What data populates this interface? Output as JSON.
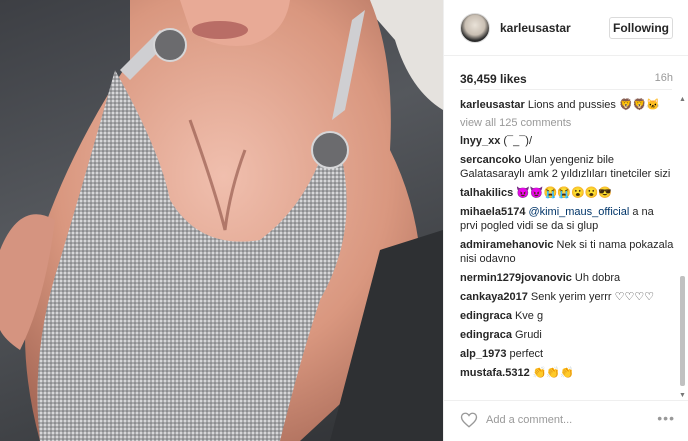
{
  "post": {
    "username": "karleusastar",
    "follow_label": "Following",
    "likes": "36,459 likes",
    "time_ago": "16h"
  },
  "caption": {
    "user": "karleusastar",
    "text": "Lions and pussies 🦁🦁🐱"
  },
  "view_all": "view all 125 comments",
  "comments": [
    {
      "user": "lnyy_xx",
      "text": "(¯_¯)/"
    },
    {
      "user": "sercancoko",
      "text": "Ulan yengeniz bile Galatasaraylı amk 2 yıldızlıları tinetciler sizi"
    },
    {
      "user": "talhakilics",
      "text": "😈😈😭😭😮😮😎"
    },
    {
      "user": "mihaela5174",
      "mention": "@kimi_maus_official",
      "text": " a na prvi pogled vidi se da si glup"
    },
    {
      "user": "admiramehanovic",
      "text": "Nek si ti nama pokazala nisi odavno"
    },
    {
      "user": "nermin1279jovanovic",
      "text": "Uh dobra"
    },
    {
      "user": "cankaya2017",
      "text": "Senk yerim yerrr ♡♡♡♡"
    },
    {
      "user": "edingraca",
      "text": "Kve g"
    },
    {
      "user": "edingraca",
      "text": "Grudi"
    },
    {
      "user": "alp_1973",
      "text": "perfect"
    },
    {
      "user": "mustafa.5312",
      "text": "👏👏👏"
    }
  ],
  "footer": {
    "placeholder": "Add a comment...",
    "more": "•••"
  },
  "icons": {
    "heart": "heart-icon",
    "avatar": "avatar",
    "more": "more-options-icon"
  }
}
